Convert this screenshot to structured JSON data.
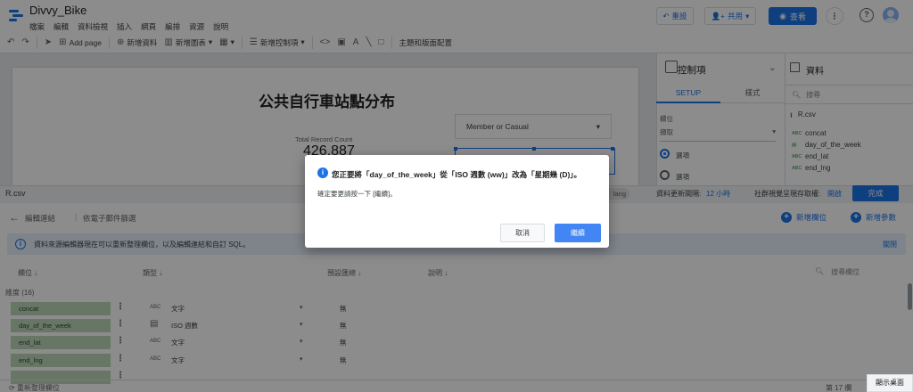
{
  "app": {
    "title": "Divvy_Bike",
    "menu": [
      "檔案",
      "編輯",
      "資料檢視",
      "插入",
      "網頁",
      "編排",
      "資源",
      "說明"
    ],
    "reset_label": "重設",
    "share_label": "共用",
    "view_label": "查看"
  },
  "toolbar": {
    "add_page": "Add page",
    "add_data": "新增資料",
    "add_chart": "新增圖表",
    "add_control": "新增控制項",
    "theme_layout": "主題和版面配置"
  },
  "canvas": {
    "report_title": "公共自行車站點分布",
    "scorecard_label": "Total Record Count",
    "scorecard_value": "426,887",
    "filter_label": "Member or Casual"
  },
  "properties": {
    "title": "控制項",
    "tab_setup": "SETUP",
    "tab_style": "樣式",
    "section_label": "欄位",
    "select_value": "擷取",
    "radio1": "選項",
    "radio2": "選項"
  },
  "data_panel": {
    "title": "資料",
    "search_placeholder": "搜尋",
    "source": "R.csv",
    "fields": [
      {
        "type": "ABC",
        "name": "concat"
      },
      {
        "type": "cal",
        "name": "day_of_the_week"
      },
      {
        "type": "ABC",
        "name": "end_lat"
      },
      {
        "type": "ABC",
        "name": "end_lng"
      }
    ]
  },
  "editor": {
    "source_name": "R.csv",
    "lang_chip": "lang",
    "freshness_label": "資料更新間隔:",
    "freshness_value": "12 小時",
    "refresh_label": "社群視覺呈現存取權:",
    "refresh_value": "開啟",
    "done_label": "完成",
    "back_label": "編輯連結",
    "email_filter": "依電子郵件篩選",
    "add_field": "新增欄位",
    "add_param": "新增參數",
    "banner_text": "資料來源編輯器現在可以重新整理欄位，以及編輯連結和自訂 SQL。",
    "banner_link": "關閉",
    "columns": [
      "欄位",
      "類型",
      "預設匯總",
      "說明"
    ],
    "search_fields": "搜尋欄位",
    "dimensions_label": "維度 (16)",
    "rows": [
      {
        "name": "concat",
        "type_code": "ABC",
        "type": "文字",
        "agg": "無"
      },
      {
        "name": "day_of_the_week",
        "type_code": "cal",
        "type": "ISO 週數",
        "agg": "無"
      },
      {
        "name": "end_lat",
        "type_code": "ABC",
        "type": "文字",
        "agg": "無"
      },
      {
        "name": "end_lng",
        "type_code": "ABC",
        "type": "文字",
        "agg": "無"
      }
    ],
    "footer_refresh": "重新整理欄位",
    "footer_count": "第 17 欄"
  },
  "dialog": {
    "title": "您正要將「day_of_the_week」從「ISO 週數 (ww)」改為「星期幾 (D)」。",
    "body": "確定要更請按一下 [繼續]。",
    "cancel": "取消",
    "continue": "繼續"
  },
  "taskbar": {
    "show_desktop": "顯示桌面"
  },
  "colors": {
    "accent": "#1a73e8",
    "field_chip": "#bcd7b8",
    "banner_bg": "#e8f0fe"
  }
}
